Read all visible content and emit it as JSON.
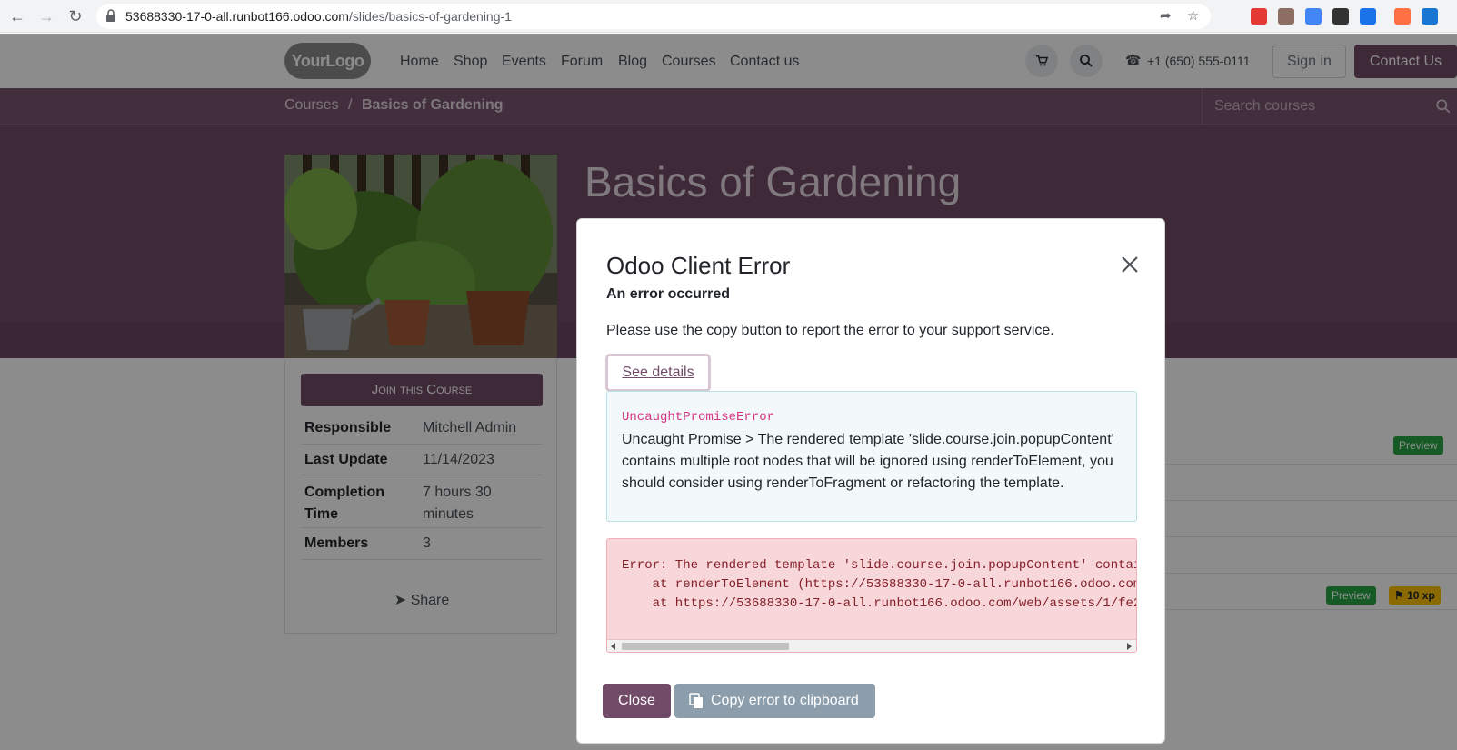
{
  "browser": {
    "url_host": "53688330-17-0-all.runbot166.odoo.com",
    "url_path": "/slides/basics-of-gardening-1"
  },
  "header": {
    "logo_text": "YourLogo",
    "menu": [
      "Home",
      "Shop",
      "Events",
      "Forum",
      "Blog",
      "Courses",
      "Contact us"
    ],
    "phone": "+1 (650) 555-0111",
    "signin": "Sign in",
    "contact_btn": "Contact Us"
  },
  "breadcrumb": {
    "root": "Courses",
    "separator": "/",
    "current": "Basics of Gardening"
  },
  "course_search": {
    "placeholder": "Search courses"
  },
  "course": {
    "title": "Basics of Gardening",
    "join_label": "Join this Course",
    "info": [
      {
        "key": "Responsible",
        "value": "Mitchell Admin"
      },
      {
        "key": "Last Update",
        "value": "11/14/2023"
      },
      {
        "key": "Completion Time",
        "value": "7 hours 30 minutes"
      },
      {
        "key": "Members",
        "value": "3"
      }
    ],
    "share_label": "Share"
  },
  "badges": {
    "preview": "Preview",
    "xp": "10 xp"
  },
  "modal": {
    "title": "Odoo Client Error",
    "subtitle": "An error occurred",
    "message": "Please use the copy button to report the error to your support service.",
    "details_label": "See details",
    "error_name": "UncaughtPromiseError",
    "error_text": "Uncaught Promise > The rendered template 'slide.course.join.popupContent' contains multiple root nodes that will be ignored using renderToElement, you should consider using renderToFragment or refactoring the template.",
    "trace_lines": [
      "Error: The rendered template 'slide.course.join.popupContent' contai",
      "    at renderToElement (https://53688330-17-0-all.runbot166.odoo.com",
      "    at https://53688330-17-0-all.runbot166.odoo.com/web/assets/1/fe2"
    ],
    "close_label": "Close",
    "copy_label": "Copy error to clipboard"
  },
  "colors": {
    "brand": "#714b67",
    "success": "#28a745",
    "warning": "#ffc107",
    "danger_bg": "#f8d7da"
  }
}
